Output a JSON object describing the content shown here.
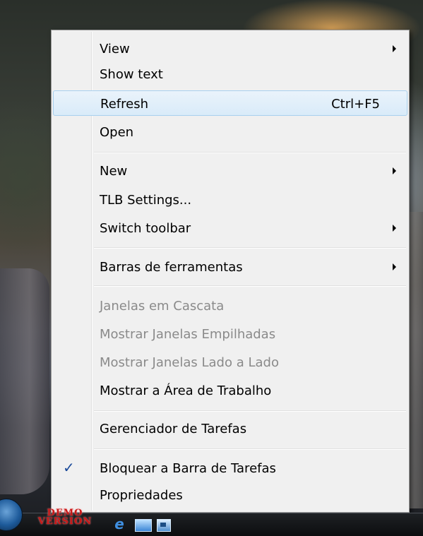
{
  "menu": {
    "items": [
      {
        "label": "View",
        "submenu": true
      },
      {
        "label": "Show text"
      },
      {
        "label": "Refresh",
        "shortcut": "Ctrl+F5",
        "highlighted": true
      },
      {
        "label": "Open"
      },
      {
        "label": "New",
        "submenu": true
      },
      {
        "label": "TLB Settings..."
      },
      {
        "label": "Switch toolbar",
        "submenu": true
      },
      {
        "label": "Barras de ferramentas",
        "submenu": true
      },
      {
        "label": "Janelas em Cascata",
        "disabled": true
      },
      {
        "label": "Mostrar Janelas Empilhadas",
        "disabled": true
      },
      {
        "label": "Mostrar Janelas Lado a Lado",
        "disabled": true
      },
      {
        "label": "Mostrar a Área de Trabalho"
      },
      {
        "label": "Gerenciador de Tarefas"
      },
      {
        "label": "Bloquear a Barra de Tarefas",
        "checked": true
      },
      {
        "label": "Propriedades"
      }
    ]
  },
  "taskbar": {
    "demo_line1": "DEMO",
    "demo_line2": "VERSION",
    "icons": [
      "internet-explorer-icon",
      "show-desktop-icon",
      "switch-windows-icon"
    ]
  },
  "colors": {
    "menu_background": "#f0f0f0",
    "highlight_border": "#a8d0ee",
    "disabled_text": "#8a8a8a",
    "check_mark": "#1a4a9a",
    "demo_text": "#c81818"
  }
}
